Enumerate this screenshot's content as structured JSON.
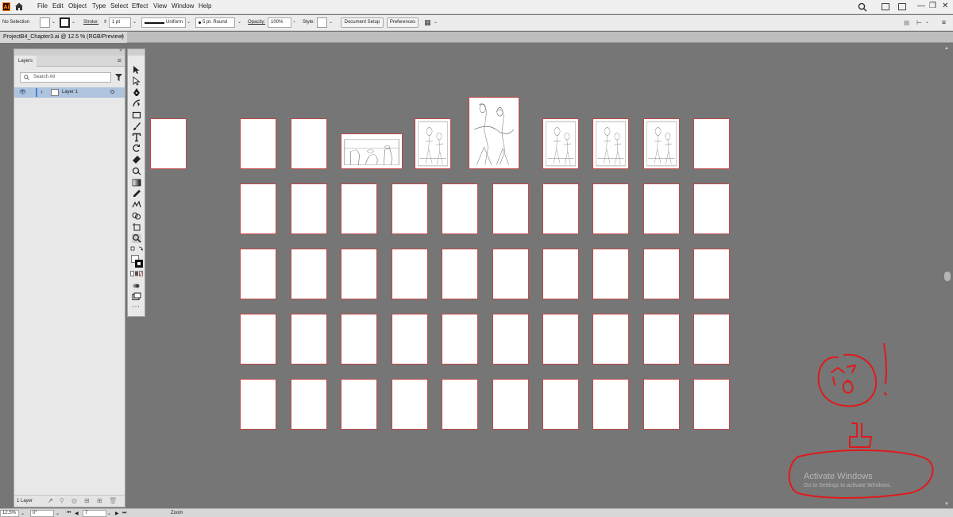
{
  "app": {
    "logo": "Ai",
    "menu": [
      "File",
      "Edit",
      "Object",
      "Type",
      "Select",
      "Effect",
      "View",
      "Window",
      "Help"
    ]
  },
  "control_bar": {
    "selection_status": "No Selection",
    "stroke_label": "Stroke:",
    "stroke_weight": "1 pt",
    "profile": "Uniform",
    "brush": "5 pt. Round",
    "opacity_label": "Opacity:",
    "opacity_value": "100%",
    "style_label": "Style:",
    "document_setup": "Document Setup",
    "preferences": "Preferences"
  },
  "document": {
    "tab_title": "ProjectB4_Chapter3.ai @ 12.5 % (RGB/Preview)",
    "close_symbol": "×"
  },
  "layers_panel": {
    "tab_label": "Layers",
    "search_placeholder": "Search All",
    "layers": [
      {
        "name": "Layer 1"
      }
    ],
    "footer_count": "1 Layer"
  },
  "status_bar": {
    "zoom": "12.5%",
    "rotation": "0°",
    "artboard_number": "7",
    "tool_name": "Zoom"
  },
  "artboards": {
    "row1": [
      "blank",
      "blank",
      "blank",
      "sketch-wide",
      "sketch-figures",
      "sketch-pair",
      "sketch-figures",
      "sketch-figures",
      "sketch-figures",
      "blank"
    ],
    "rows_blank": 4,
    "per_row": 10
  },
  "watermark": {
    "title": "Activate Windows",
    "subtitle": "Go to Settings to activate Windows."
  },
  "colors": {
    "canvas": "#767676",
    "artboard_border": "#c24848",
    "scribble": "#e0191c",
    "selected_layer": "#aec4de"
  }
}
